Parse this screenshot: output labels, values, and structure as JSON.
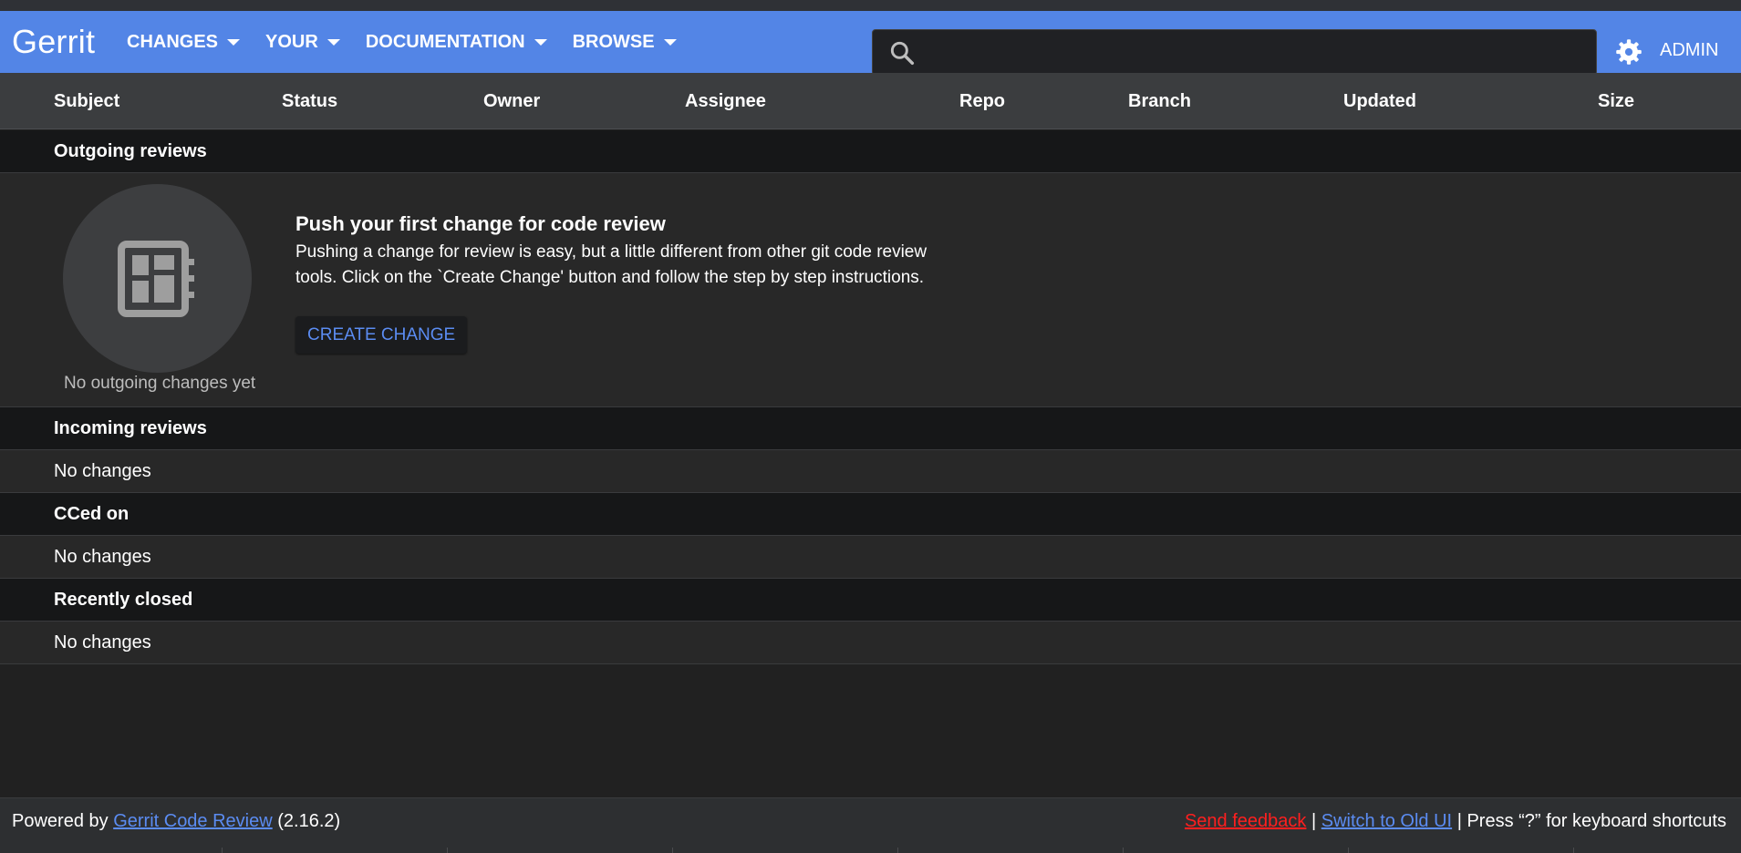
{
  "app": {
    "logo": "Gerrit"
  },
  "nav": [
    {
      "label": "CHANGES"
    },
    {
      "label": "YOUR"
    },
    {
      "label": "DOCUMENTATION"
    },
    {
      "label": "BROWSE"
    }
  ],
  "search": {
    "value": "",
    "placeholder": ""
  },
  "account": {
    "label": "ADMIN"
  },
  "columns": [
    "Subject",
    "Status",
    "Owner",
    "Assignee",
    "Repo",
    "Branch",
    "Updated",
    "Size"
  ],
  "sections": {
    "outgoing": {
      "title": "Outgoing reviews",
      "empty_caption": "No outgoing changes yet",
      "push_title": "Push your first change for code review",
      "push_text": "Pushing a change for review is easy, but a little different from other git code review tools. Click on the `Create Change' button and follow the step by step instructions.",
      "create_button": "CREATE CHANGE"
    },
    "incoming": {
      "title": "Incoming reviews",
      "empty": "No changes"
    },
    "cced": {
      "title": "CCed on",
      "empty": "No changes"
    },
    "closed": {
      "title": "Recently closed",
      "empty": "No changes"
    }
  },
  "footer": {
    "powered_by": "Powered by",
    "gerrit_link": "Gerrit Code Review",
    "version": "(2.16.2)",
    "send_feedback": "Send feedback",
    "separator": "|",
    "switch_ui": "Switch to Old UI",
    "shortcuts": "| Press “?” for keyboard shortcuts"
  },
  "colors": {
    "header": "#5385e6",
    "link": "#5b8cf2",
    "feedback": "#ff1f1f"
  },
  "icons": {
    "search": "search-icon",
    "settings": "gear-icon",
    "empty": "dashboard-icon"
  }
}
